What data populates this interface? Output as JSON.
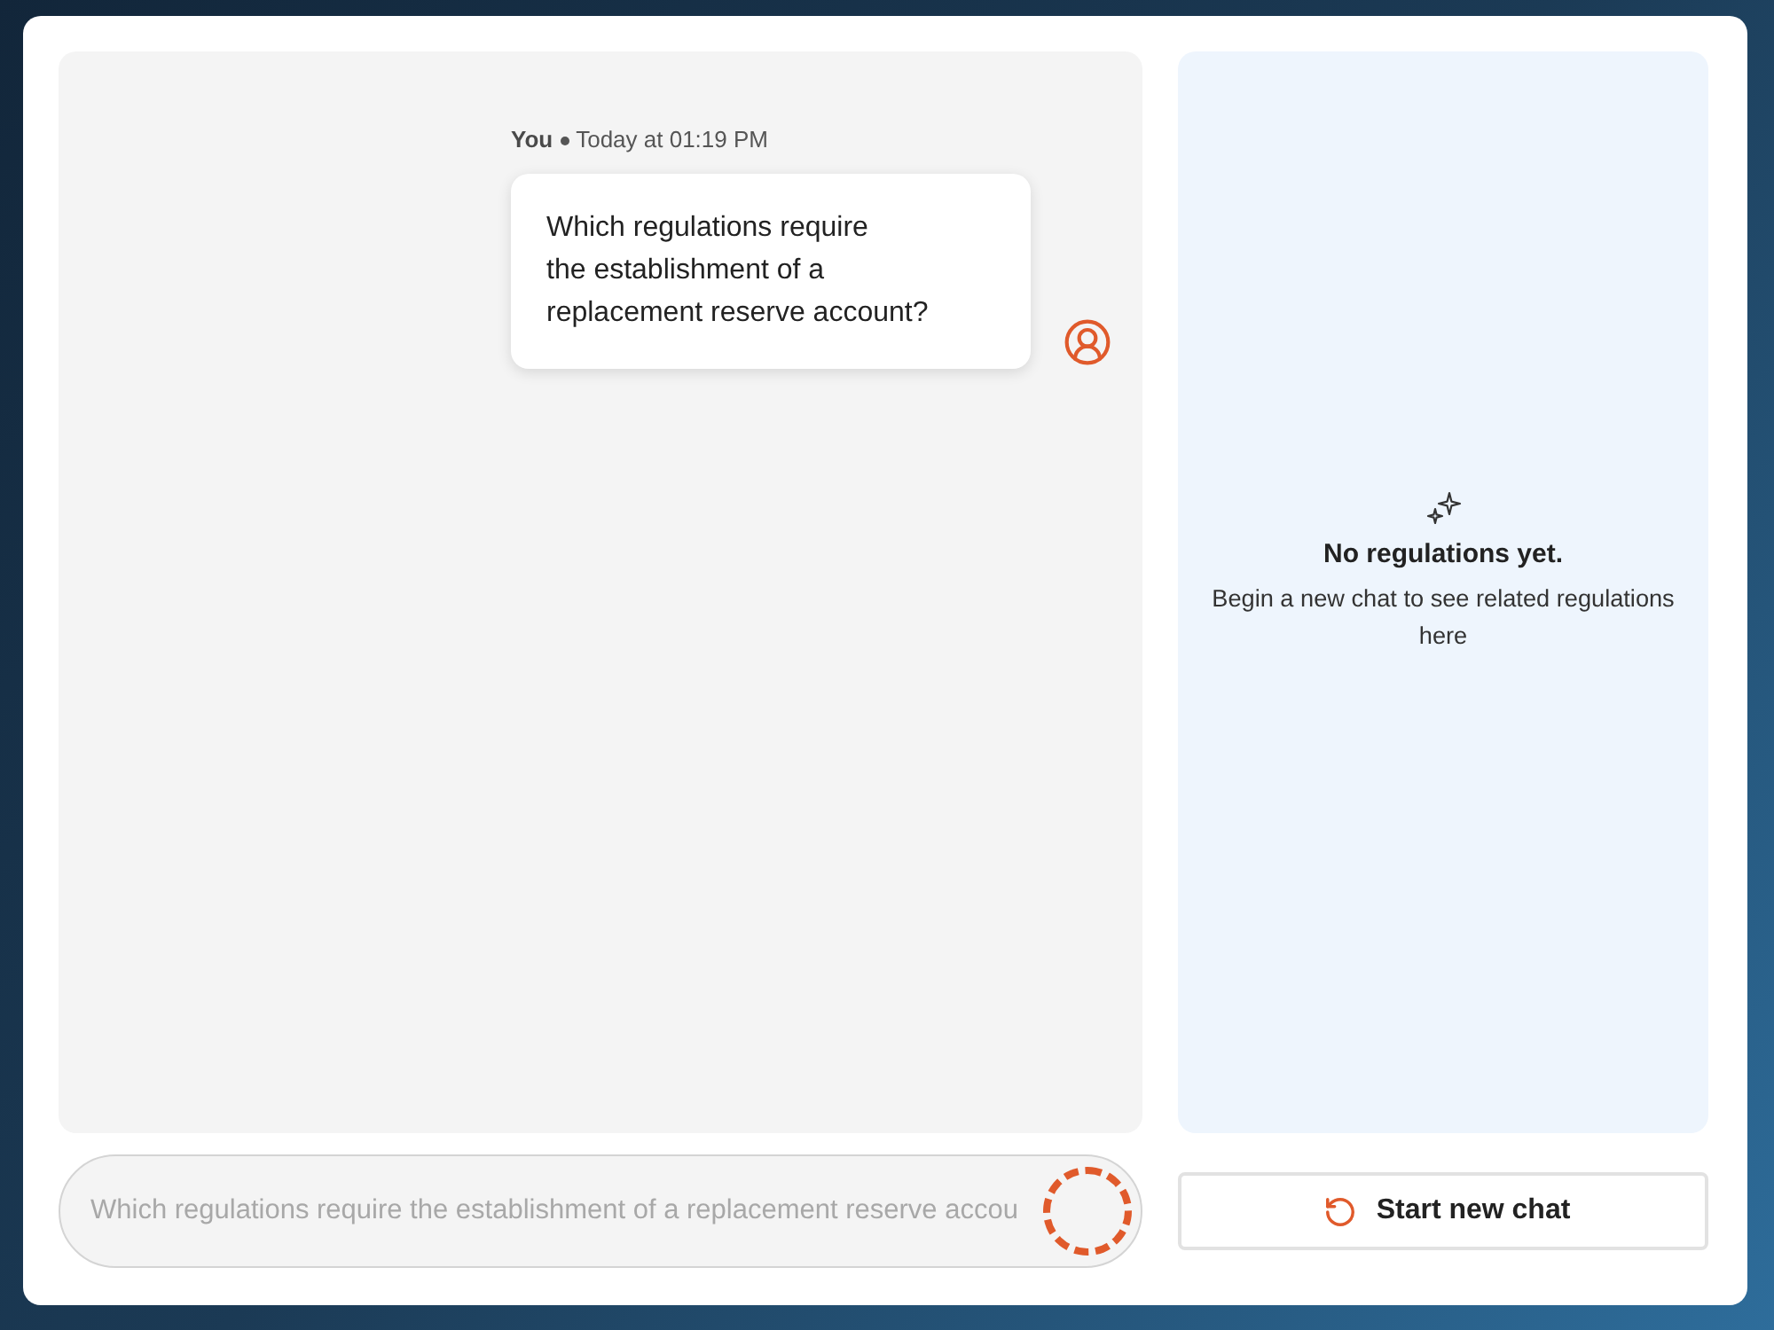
{
  "chat": {
    "messages": [
      {
        "sender": "You",
        "time": "Today at 01:19 PM",
        "text": "Which regulations require\nthe establishment of a\nreplacement reserve account?"
      }
    ]
  },
  "regulations_panel": {
    "title": "No regulations yet.",
    "message": "Begin a new chat to see related regulations here"
  },
  "composer": {
    "value": "Which regulations require the establishment of a replacement reserve accou",
    "disabled": true,
    "loading": true
  },
  "new_chat_button": {
    "label": "Start new chat"
  }
}
